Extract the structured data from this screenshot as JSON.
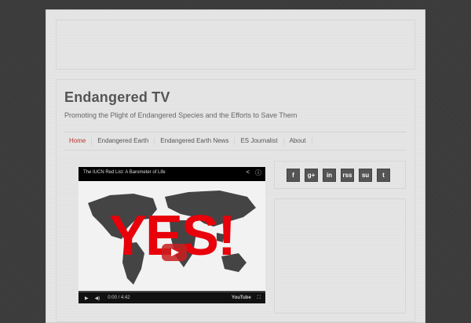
{
  "site": {
    "title": "Endangered TV",
    "tagline": "Promoting the Plight of Endangered Species and the Efforts to Save Them"
  },
  "nav": {
    "items": [
      {
        "label": "Home",
        "active": true
      },
      {
        "label": "Endangered Earth",
        "active": false
      },
      {
        "label": "Endangered Earth News",
        "active": false
      },
      {
        "label": "ES Journalist",
        "active": false
      },
      {
        "label": "About",
        "active": false
      }
    ]
  },
  "video": {
    "title": "The IUCN Red List: A Barometer of Life",
    "overlay_text": "YES!",
    "time": "0:00 / 4:42",
    "brand": "YouTube"
  },
  "social": {
    "icons": [
      {
        "name": "facebook-icon",
        "glyph": "f"
      },
      {
        "name": "google-plus-icon",
        "glyph": "g+"
      },
      {
        "name": "linkedin-icon",
        "glyph": "in"
      },
      {
        "name": "rss-icon",
        "glyph": "rss"
      },
      {
        "name": "stumbleupon-icon",
        "glyph": "su"
      },
      {
        "name": "twitter-icon",
        "glyph": "t"
      }
    ]
  },
  "colors": {
    "accent": "#b8332e",
    "background": "#3a3a3a",
    "page": "#e9e9e9",
    "overlay_red": "#e8000a"
  }
}
